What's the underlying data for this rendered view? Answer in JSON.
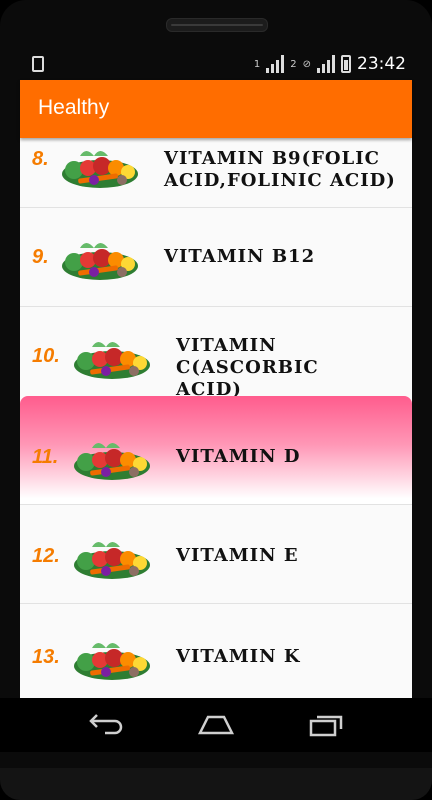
{
  "status_bar": {
    "sim1": "1",
    "sim2": "2",
    "time": "23:42"
  },
  "app_bar": {
    "title": "Healthy"
  },
  "items": [
    {
      "number": "8.",
      "name": "VITAMIN B9(FOLIC ACID,FOLINIC ACID)",
      "line1": "VITAMIN B9(FOLIC",
      "line2": "ACID,FOLINIC ACID)"
    },
    {
      "number": "9.",
      "name": "VITAMIN B12",
      "line1": "VITAMIN B12"
    },
    {
      "number": "10.",
      "name": "VITAMIN C(ASCORBIC ACID)",
      "line1": "VITAMIN C(ASCORBIC",
      "line2": "ACID)"
    },
    {
      "number": "11.",
      "name": "VITAMIN D",
      "line1": "VITAMIN D",
      "selected": true
    },
    {
      "number": "12.",
      "name": "VITAMIN E",
      "line1": "VITAMIN E"
    },
    {
      "number": "13.",
      "name": "VITAMIN K",
      "line1": "VITAMIN K"
    }
  ],
  "icons": {
    "nav_back": "back-arrow-icon",
    "nav_home": "home-icon",
    "nav_recents": "recent-apps-icon",
    "item_image": "vegetables-icon"
  },
  "colors": {
    "app_bar": "#ff6d00",
    "number": "#f57c00",
    "selected_top": "#ff5c8d",
    "list_background": "#fafafa"
  }
}
